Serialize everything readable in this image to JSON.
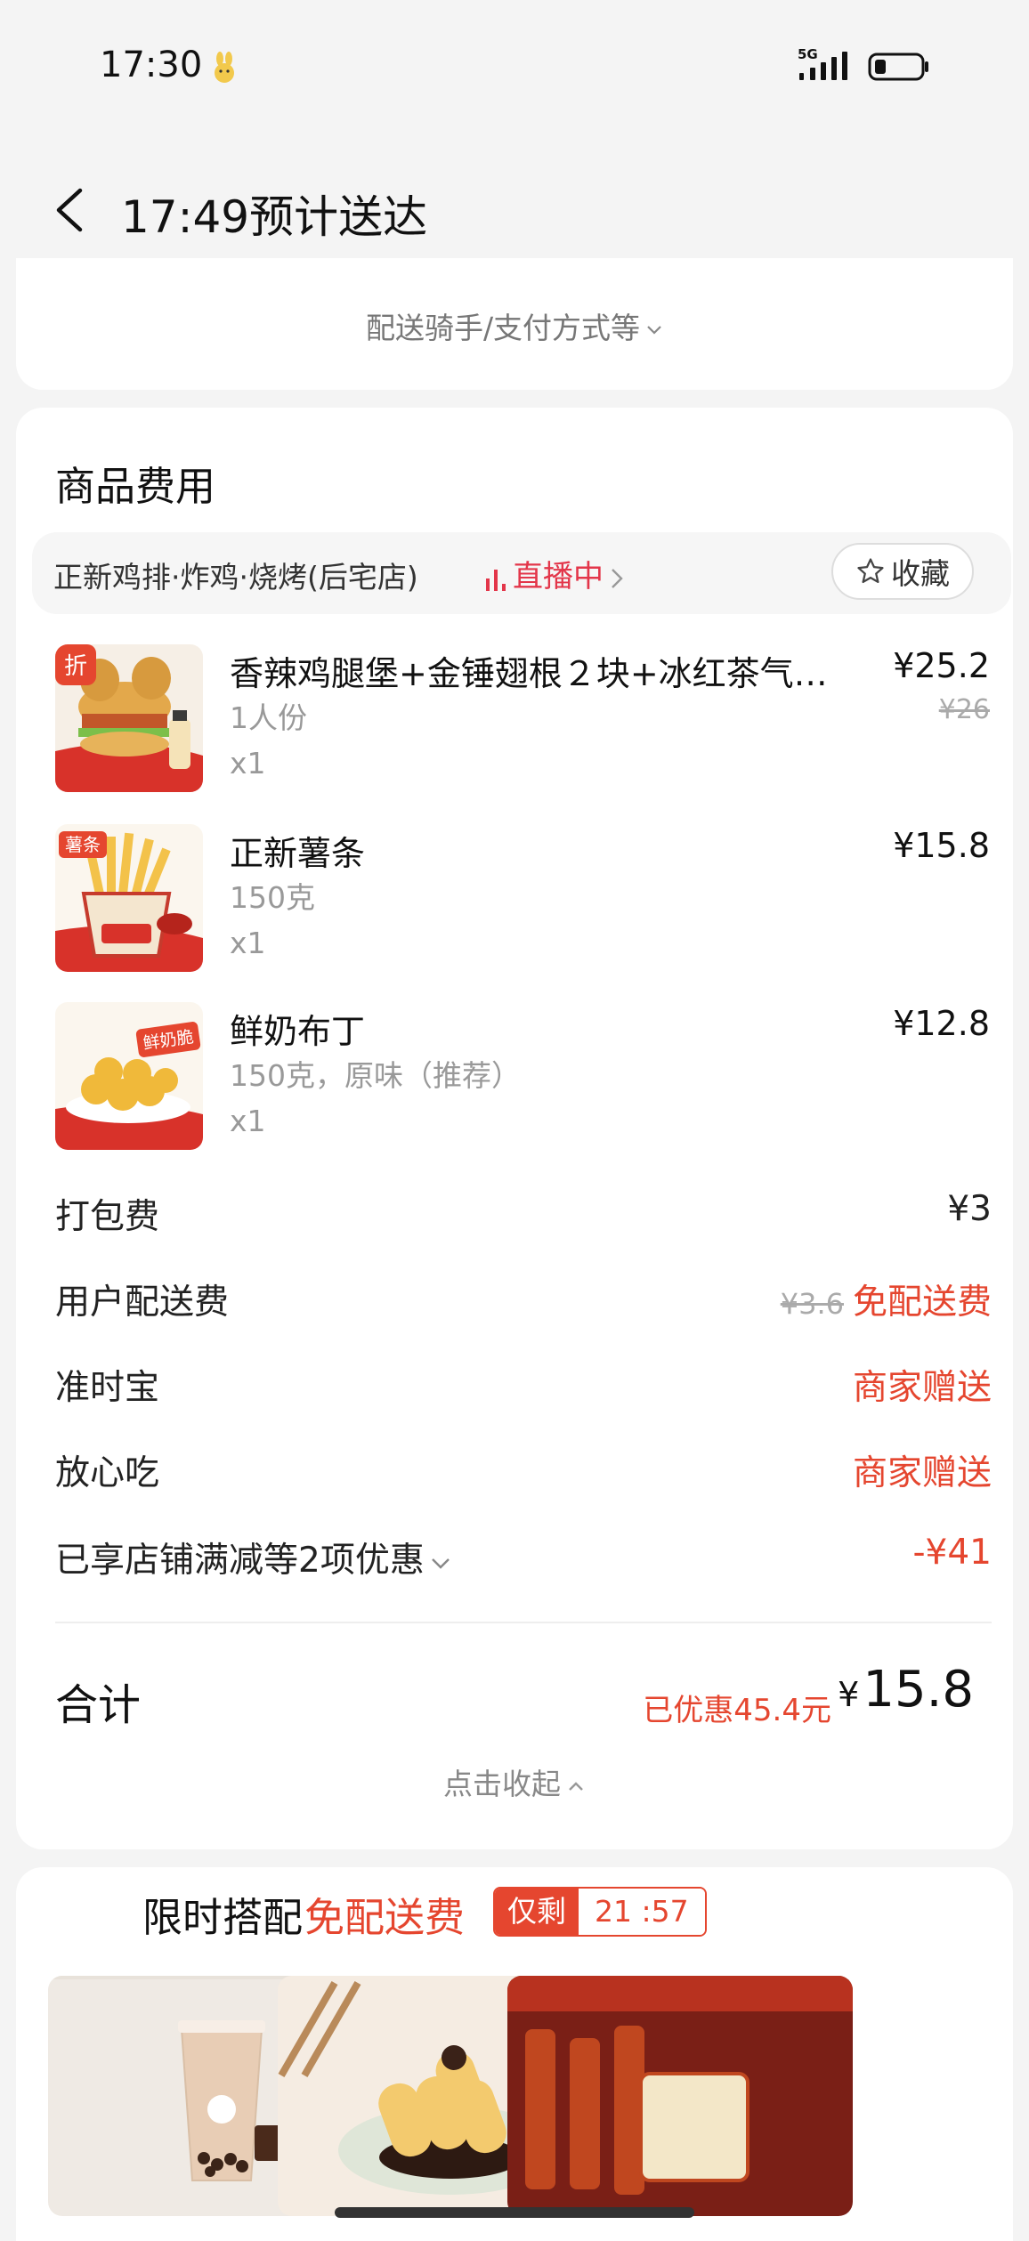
{
  "status_bar": {
    "time": "17:30",
    "network": "5G"
  },
  "header": {
    "title": "17:49预计送达"
  },
  "delivery_toggle": {
    "label": "配送骑手/支付方式等"
  },
  "goods": {
    "section_title": "商品费用",
    "store_name": "正新鸡排·炸鸡·烧烤(后宅店)",
    "live_label": "直播中",
    "favorite_label": "收藏",
    "items": [
      {
        "name": "香辣鸡腿堡+金锤翅根２块+冰红茶气…",
        "spec": "1人份",
        "qty": "x1",
        "price": "¥25.2",
        "original_price": "¥26",
        "badge": "折"
      },
      {
        "name": "正新薯条",
        "spec": "150克",
        "qty": "x1",
        "price": "¥15.8",
        "badge": "薯条"
      },
      {
        "name": "鲜奶布丁",
        "spec": "150克，原味（推荐）",
        "qty": "x1",
        "price": "¥12.8",
        "badge": "鲜奶脆"
      }
    ],
    "fees": {
      "packing": {
        "label": "打包费",
        "value": "¥3"
      },
      "delivery": {
        "label": "用户配送费",
        "original": "¥3.6",
        "value": "免配送费"
      },
      "ontime": {
        "label": "准时宝",
        "value": "商家赠送"
      },
      "safe": {
        "label": "放心吃",
        "value": "商家赠送"
      },
      "discount": {
        "label": "已享店铺满减等2项优惠",
        "value": "-¥41"
      }
    },
    "total": {
      "label": "合计",
      "saved": "已优惠45.4元",
      "currency": "¥",
      "amount": "15.8"
    },
    "collapse_label": "点击收起"
  },
  "promo": {
    "title": "限时搭配",
    "title_highlight": "免配送费",
    "countdown_tag": "仅剩",
    "countdown": "21 :57"
  },
  "colors": {
    "accent_red": "#e5462f",
    "live_red": "#e3364a"
  }
}
